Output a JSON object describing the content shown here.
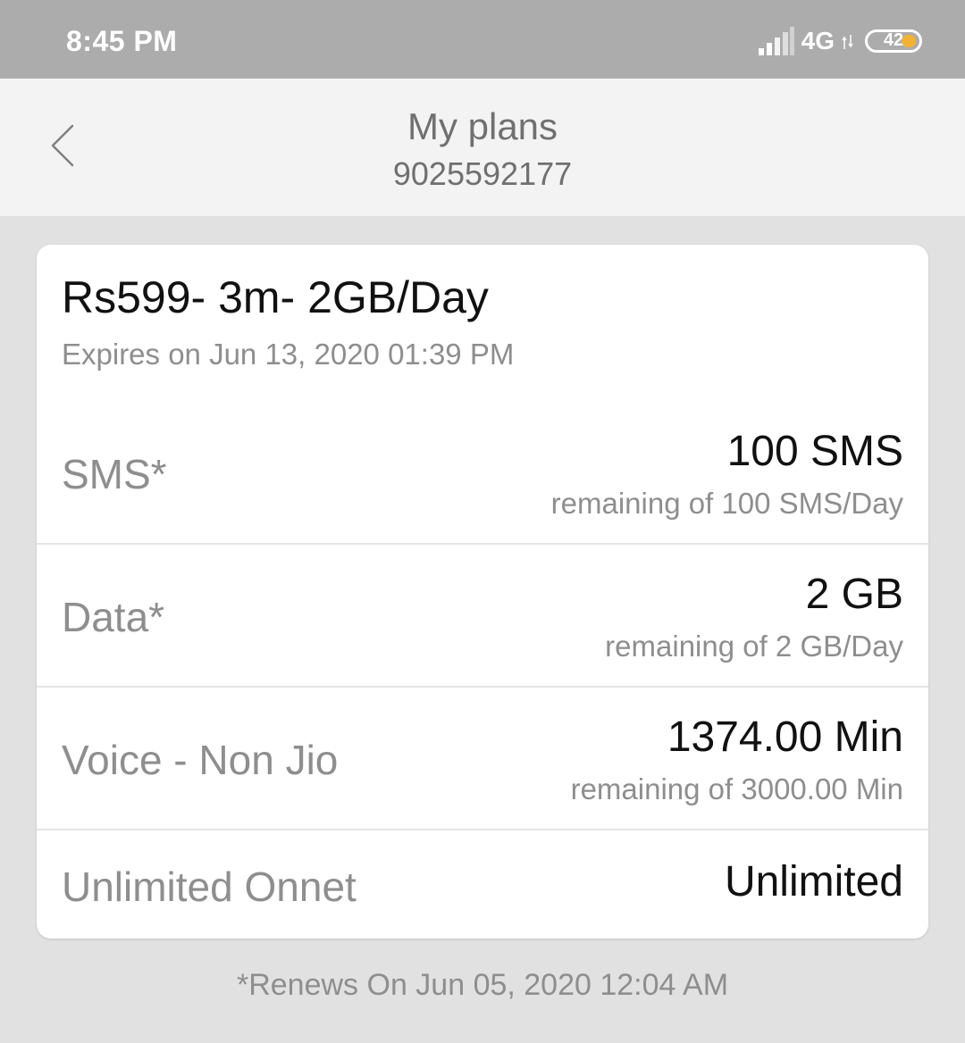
{
  "status_bar": {
    "time": "8:45 PM",
    "network": "4G",
    "battery": "42",
    "battery_color": "#f2b233"
  },
  "header": {
    "title": "My plans",
    "phone_number": "9025592177",
    "back_icon": "chevron-left-icon"
  },
  "plan": {
    "name": "Rs599- 3m- 2GB/Day",
    "expiry": "Expires on Jun 13, 2020 01:39 PM",
    "rows": [
      {
        "label": "SMS*",
        "value": "100 SMS",
        "sub": "remaining of 100 SMS/Day"
      },
      {
        "label": "Data*",
        "value": "2 GB",
        "sub": "remaining of 2 GB/Day"
      },
      {
        "label": "Voice - Non Jio",
        "value": "1374.00 Min",
        "sub": "remaining of 3000.00 Min"
      },
      {
        "label": "Unlimited Onnet",
        "value": "Unlimited",
        "sub": ""
      }
    ]
  },
  "footer": {
    "renew_note": "*Renews On Jun 05, 2020 12:04 AM"
  }
}
